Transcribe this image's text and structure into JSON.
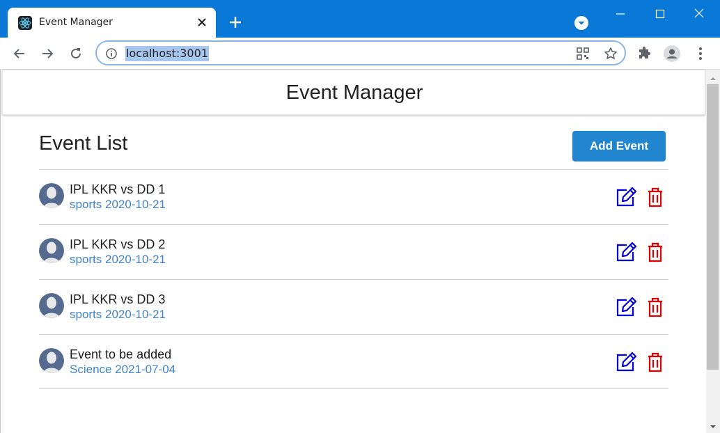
{
  "browser": {
    "tab": {
      "title": "Event Manager",
      "favicon": "react-logo-icon"
    },
    "address_bar": {
      "url": "localhost:3001"
    },
    "colors": {
      "titlebar": "#0a78d6",
      "omnibox_border": "#8ab4e8",
      "url_highlight": "#a8c7ee"
    }
  },
  "app": {
    "header_title": "Event Manager",
    "list_title": "Event List",
    "add_button_label": "Add Event",
    "colors": {
      "primary": "#2185d0",
      "edit": "#0000dd",
      "delete": "#dd0000",
      "meta_text": "#4183c4"
    },
    "events": [
      {
        "name": "IPL KKR vs DD 1",
        "meta": "sports 2020-10-21"
      },
      {
        "name": "IPL KKR vs DD 2",
        "meta": "sports 2020-10-21"
      },
      {
        "name": "IPL KKR vs DD 3",
        "meta": "sports 2020-10-21"
      },
      {
        "name": "Event to be added",
        "meta": "Science 2021-07-04"
      }
    ]
  }
}
